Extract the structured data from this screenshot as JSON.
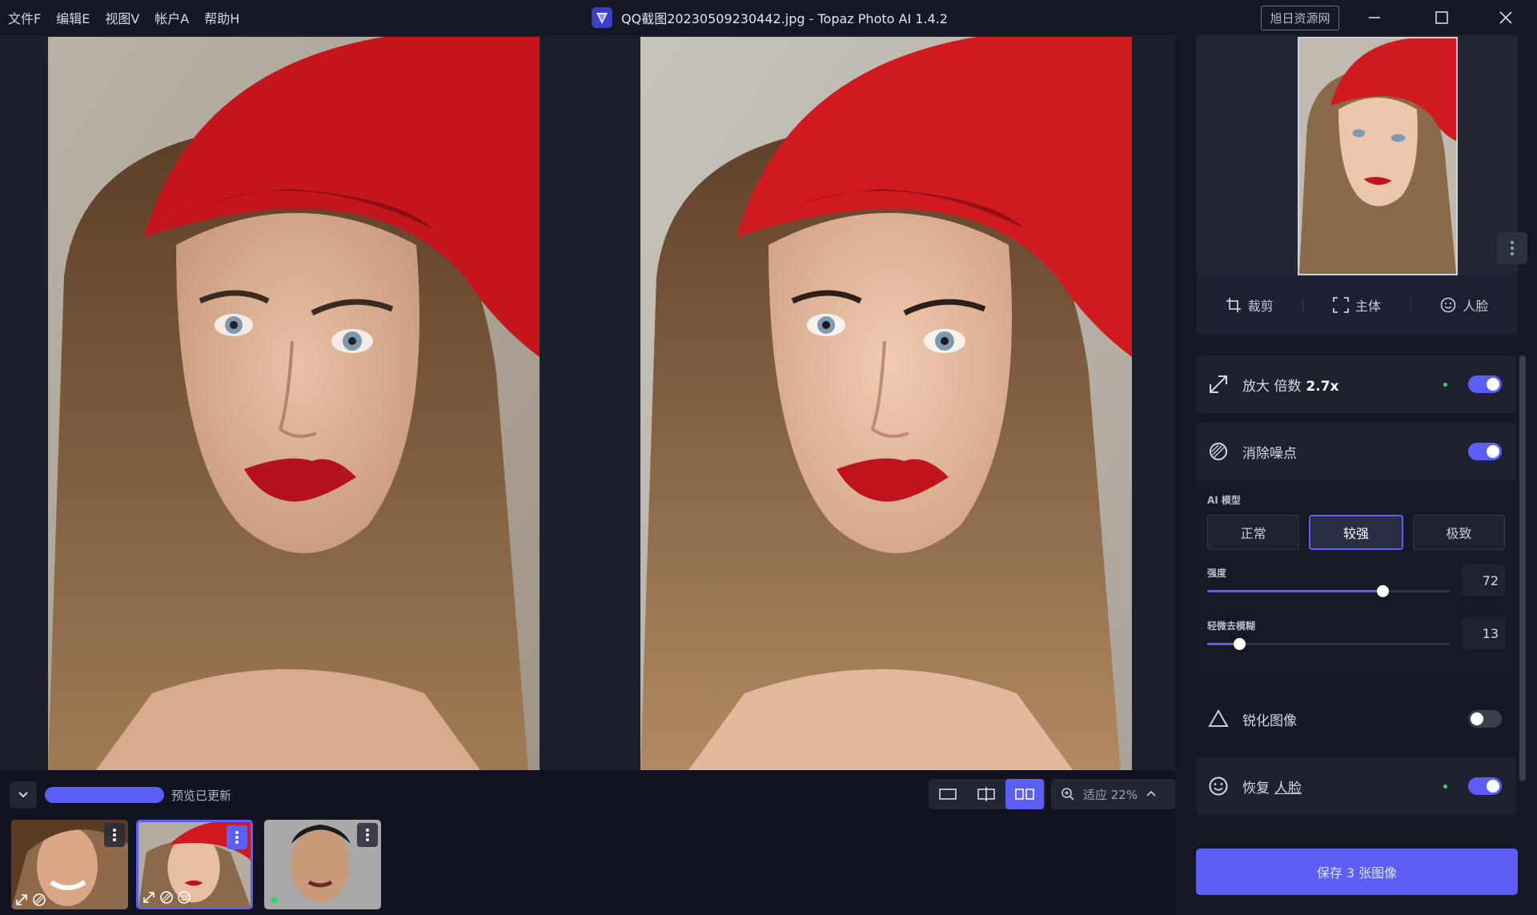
{
  "menu": [
    "文件F",
    "编辑E",
    "视图V",
    "帐户A",
    "帮助H"
  ],
  "window": {
    "title": "QQ截图20230509230442.jpg - Topaz Photo AI 1.4.2",
    "watermark": "旭日资源网"
  },
  "bottom": {
    "progress_label": "预览已更新",
    "progress_fraction": 1.0,
    "zoom_label": "适应 22%",
    "view_modes": [
      "single",
      "split",
      "side-by-side"
    ],
    "active_view": "side-by-side"
  },
  "thumbnails": [
    {
      "name": "smiling-woman",
      "selected": false,
      "icons": [
        "upscale-icon",
        "denoise-icon"
      ]
    },
    {
      "name": "red-beret-woman",
      "selected": true,
      "icons": [
        "upscale-icon",
        "denoise-icon",
        "face-icon"
      ]
    },
    {
      "name": "man-portrait",
      "selected": false,
      "icons": [
        "status-dot"
      ]
    }
  ],
  "tools": {
    "crop": "裁剪",
    "subject": "主体",
    "face": "人脸"
  },
  "upscale": {
    "label": "放大 倍数",
    "value": "2.7x",
    "enabled": true
  },
  "denoise": {
    "label": "消除噪点",
    "enabled": true,
    "model_label": "AI 模型",
    "models": [
      "正常",
      "较强",
      "极致"
    ],
    "active_model": "较强",
    "strength_label": "强度",
    "strength": "72",
    "strength_fraction": 0.72,
    "deblur_label": "轻微去模糊",
    "deblur": "13",
    "deblur_fraction": 0.13
  },
  "sharpen": {
    "label": "锐化图像",
    "enabled": false
  },
  "face_recovery": {
    "label": "恢复",
    "link": "人脸",
    "enabled": true
  },
  "save_button": "保存 3 张图像",
  "colors": {
    "accent": "#5b5ff5",
    "active_dot": "#3ecf6a",
    "beret": "#c4161c",
    "lips": "#b5121b"
  }
}
